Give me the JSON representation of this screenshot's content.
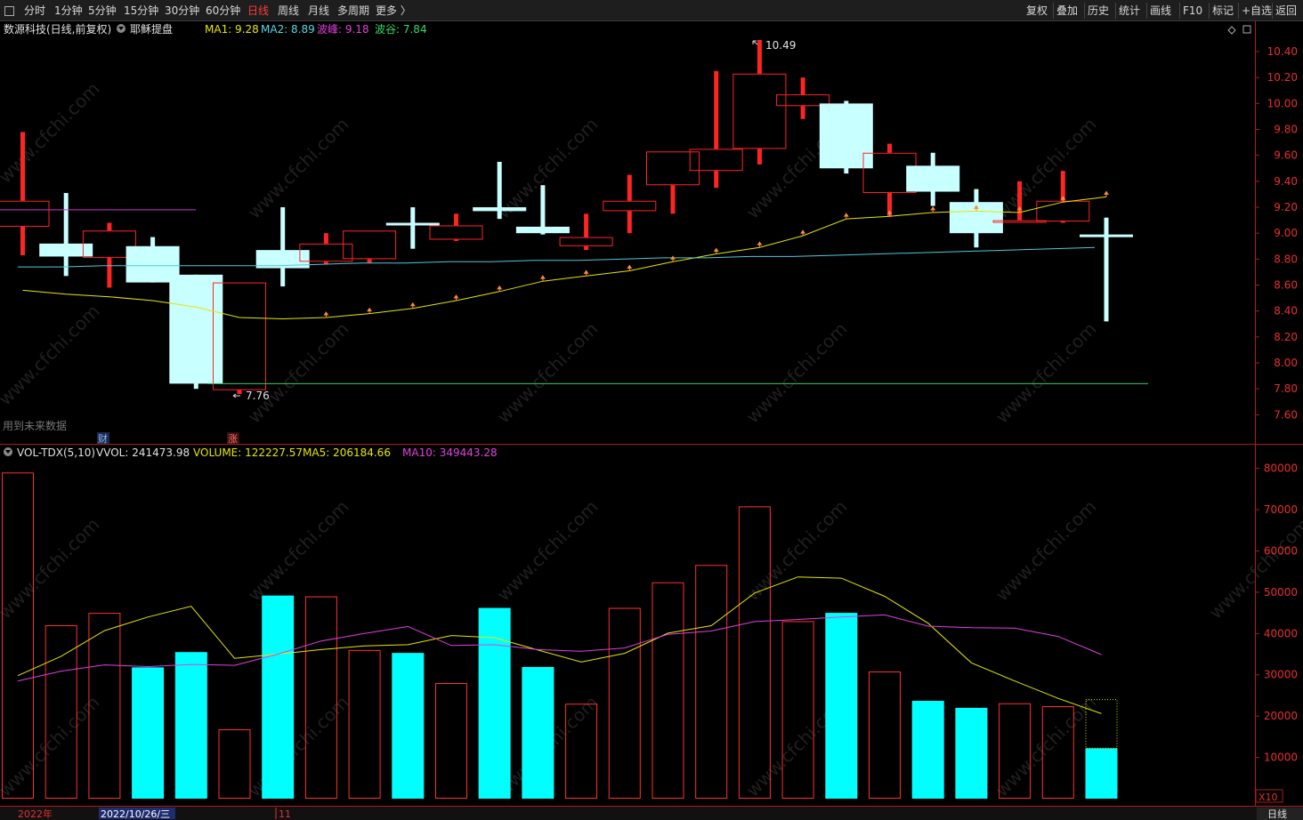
{
  "toolbar": {
    "menu_icon": "small-box-icon",
    "periods": [
      "分时",
      "1分钟",
      "5分钟",
      "15分钟",
      "30分钟",
      "60分钟",
      "日线",
      "周线",
      "月线",
      "多周期",
      "更多 〉"
    ],
    "active_period": "日线",
    "right_buttons": [
      "复权",
      "叠加",
      "历史",
      "统计",
      "画线",
      "F10",
      "标记",
      "+自选",
      "返回"
    ]
  },
  "main_header": {
    "title": "数源科技(日线,前复权)",
    "indicator_icon": "circle-down-icon",
    "indicator_name": "耶稣提盘",
    "ma1": "MA1: 9.28",
    "ma2": "MA2: 8.89",
    "peak": "波峰: 9.18",
    "trough": "波谷: 7.84",
    "right_icons": [
      "diamond-icon",
      "square-icon"
    ]
  },
  "price_labels": {
    "high": "10.49",
    "low": "7.76"
  },
  "future_data_label": "用到未来数据",
  "event_marks": {
    "finance": "财",
    "limit_up": "涨"
  },
  "volume_header": {
    "indicator": "VOL-TDX(5,10)",
    "vvol": "VVOL: 241473.98",
    "volume": "VOLUME: 122227.57",
    "ma5": "MA5: 206184.66",
    "ma10": "MA10: 349443.28"
  },
  "price_axis": [
    "10.40",
    "10.20",
    "10.00",
    "9.80",
    "9.60",
    "9.40",
    "9.20",
    "9.00",
    "8.80",
    "8.60",
    "8.40",
    "8.20",
    "8.00",
    "7.80",
    "7.60"
  ],
  "volume_axis": [
    "80000",
    "70000",
    "60000",
    "50000",
    "40000",
    "30000",
    "20000",
    "10000"
  ],
  "volume_axis_unit": "X10",
  "date_bar": {
    "year": "2022年",
    "cursor_date": "2022/10/26/三",
    "month": "11",
    "period_badge": "日线"
  },
  "colors": {
    "up": "#ff2424",
    "down": "#c8ffff",
    "vol_down": "#00ffff",
    "ma1": "#e6e600",
    "ma2": "#4fc9d8",
    "peak": "#cc33cc",
    "trough": "#33cc66",
    "axis": "#b11a1a"
  },
  "chart_data": [
    {
      "type": "candlestick",
      "title": "数源科技(日线,前复权)",
      "y_range": [
        7.5,
        10.55
      ],
      "candles": [
        {
          "open": 9.05,
          "close": 9.25,
          "high": 9.78,
          "low": 8.83
        },
        {
          "open": 8.92,
          "close": 8.82,
          "high": 9.31,
          "low": 8.67
        },
        {
          "open": 8.81,
          "close": 9.02,
          "high": 9.08,
          "low": 8.58
        },
        {
          "open": 8.9,
          "close": 8.62,
          "high": 8.97,
          "low": 8.62
        },
        {
          "open": 8.68,
          "close": 7.84,
          "high": 8.68,
          "low": 7.8
        },
        {
          "open": 7.79,
          "close": 8.62,
          "high": 8.62,
          "low": 7.76
        },
        {
          "open": 8.87,
          "close": 8.73,
          "high": 9.2,
          "low": 8.59
        },
        {
          "open": 8.78,
          "close": 8.92,
          "high": 9.0,
          "low": 8.76
        },
        {
          "open": 8.8,
          "close": 9.02,
          "high": 9.02,
          "low": 8.77
        },
        {
          "open": 9.08,
          "close": 9.08,
          "high": 9.2,
          "low": 8.88
        },
        {
          "open": 8.95,
          "close": 9.06,
          "high": 9.15,
          "low": 8.94
        },
        {
          "open": 9.2,
          "close": 9.17,
          "high": 9.55,
          "low": 9.11
        },
        {
          "open": 9.05,
          "close": 9.0,
          "high": 9.37,
          "low": 8.99
        },
        {
          "open": 8.9,
          "close": 8.97,
          "high": 9.15,
          "low": 8.87
        },
        {
          "open": 9.17,
          "close": 9.25,
          "high": 9.45,
          "low": 9.0
        },
        {
          "open": 9.37,
          "close": 9.63,
          "high": 9.63,
          "low": 9.15
        },
        {
          "open": 9.48,
          "close": 9.65,
          "high": 10.25,
          "low": 9.35
        },
        {
          "open": 9.65,
          "close": 10.23,
          "high": 10.49,
          "low": 9.53
        },
        {
          "open": 9.98,
          "close": 10.07,
          "high": 10.2,
          "low": 9.88
        },
        {
          "open": 10.0,
          "close": 9.5,
          "high": 10.02,
          "low": 9.46
        },
        {
          "open": 9.31,
          "close": 9.62,
          "high": 9.69,
          "low": 9.13
        },
        {
          "open": 9.52,
          "close": 9.32,
          "high": 9.62,
          "low": 9.21
        },
        {
          "open": 9.24,
          "close": 9.0,
          "high": 9.34,
          "low": 8.89
        },
        {
          "open": 9.08,
          "close": 9.1,
          "high": 9.4,
          "low": 9.08
        },
        {
          "open": 9.09,
          "close": 9.25,
          "high": 9.48,
          "low": 9.08
        },
        {
          "open": 8.99,
          "close": 8.99,
          "high": 9.12,
          "low": 8.32
        }
      ],
      "ma1": [
        8.56,
        8.53,
        8.51,
        8.48,
        8.43,
        8.35,
        8.34,
        8.35,
        8.38,
        8.42,
        8.48,
        8.55,
        8.63,
        8.67,
        8.71,
        8.78,
        8.84,
        8.89,
        8.98,
        9.11,
        9.13,
        9.16,
        9.17,
        9.16,
        9.24,
        9.28
      ],
      "ma2": [
        8.74,
        8.74,
        8.75,
        8.75,
        8.75,
        8.75,
        8.75,
        8.76,
        8.77,
        8.77,
        8.78,
        8.78,
        8.79,
        8.79,
        8.8,
        8.81,
        8.81,
        8.82,
        8.82,
        8.83,
        8.84,
        8.85,
        8.86,
        8.87,
        8.88,
        8.89
      ],
      "peak_level": 9.18,
      "trough_level": 7.84
    },
    {
      "type": "bar",
      "title": "VOL-TDX(5,10)",
      "y_range": [
        0,
        81000
      ],
      "values": [
        79000,
        42000,
        45000,
        31800,
        35500,
        16800,
        49200,
        49000,
        36000,
        35300,
        28000,
        46200,
        31900,
        23000,
        46200,
        52400,
        56600,
        70800,
        43000,
        45000,
        30800,
        23700,
        22000,
        23100,
        22400,
        12200
      ],
      "direction": [
        "up",
        "up",
        "up",
        "down",
        "down",
        "up",
        "down",
        "up",
        "up",
        "down",
        "up",
        "down",
        "down",
        "up",
        "up",
        "up",
        "up",
        "up",
        "up",
        "down",
        "up",
        "down",
        "down",
        "up",
        "up",
        "down"
      ],
      "ma5": [
        29800,
        34500,
        40700,
        44000,
        46600,
        34000,
        35000,
        36100,
        37000,
        37300,
        39500,
        39000,
        36000,
        33100,
        35200,
        40100,
        41900,
        49800,
        53700,
        53400,
        49000,
        42500,
        32900,
        28500,
        24300,
        20600
      ],
      "ma10": [
        28500,
        30900,
        32400,
        32000,
        32500,
        32300,
        35000,
        38200,
        40000,
        41700,
        37100,
        37300,
        36100,
        35700,
        36500,
        39800,
        40600,
        42900,
        43400,
        44000,
        44500,
        41800,
        41400,
        41300,
        39300,
        34900
      ]
    }
  ]
}
